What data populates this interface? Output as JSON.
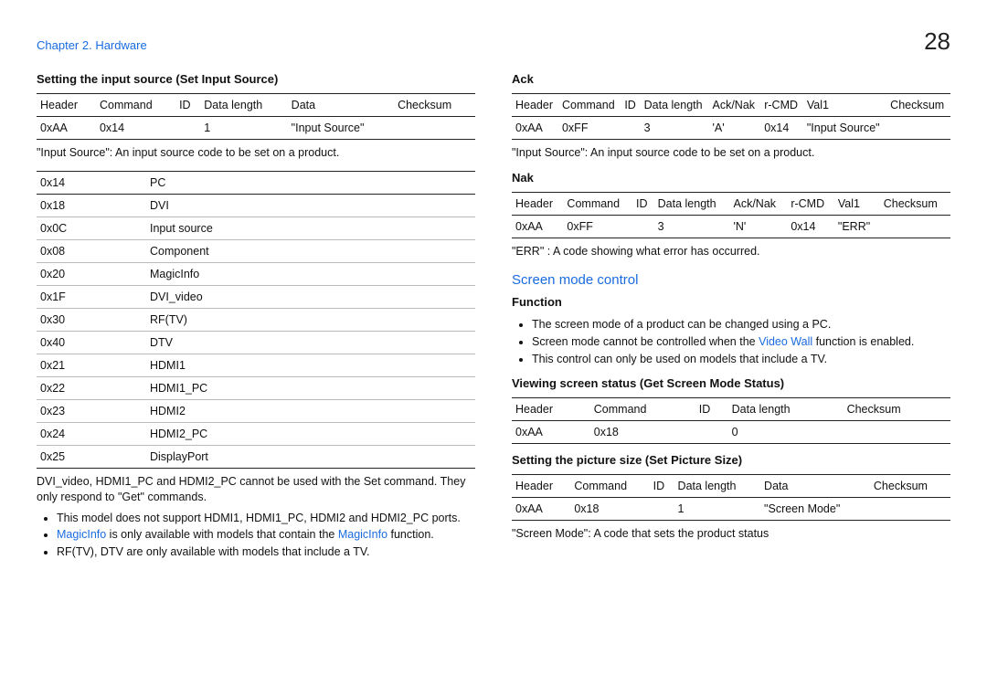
{
  "chapter": "Chapter 2. Hardware",
  "page_number": "28",
  "left": {
    "set_input_source": {
      "title": "Setting the input source (Set Input Source)",
      "table": {
        "headers": [
          "Header",
          "Command",
          "ID",
          "Data length",
          "Data",
          "Checksum"
        ],
        "row": [
          "0xAA",
          "0x14",
          "",
          "1",
          "\"Input Source\"",
          ""
        ]
      },
      "desc": "\"Input Source\": An input source code to be set on a product.",
      "codes": {
        "rows": [
          [
            "0x14",
            "PC"
          ],
          [
            "0x18",
            "DVI"
          ],
          [
            "0x0C",
            "Input source"
          ],
          [
            "0x08",
            "Component"
          ],
          [
            "0x20",
            "MagicInfo"
          ],
          [
            "0x1F",
            "DVI_video"
          ],
          [
            "0x30",
            "RF(TV)"
          ],
          [
            "0x40",
            "DTV"
          ],
          [
            "0x21",
            "HDMI1"
          ],
          [
            "0x22",
            "HDMI1_PC"
          ],
          [
            "0x23",
            "HDMI2"
          ],
          [
            "0x24",
            "HDMI2_PC"
          ],
          [
            "0x25",
            "DisplayPort"
          ]
        ]
      },
      "note1": "DVI_video, HDMI1_PC and HDMI2_PC cannot be used with the Set command. They only respond to \"Get\" commands.",
      "bullets": [
        {
          "pre": "This model does not support HDMI1, HDMI1_PC, HDMI2 and HDMI2_PC ports."
        },
        {
          "pre": "",
          "link1": "MagicInfo",
          "mid": " is only available with models that contain the ",
          "link2": "MagicInfo",
          "post": " function."
        },
        {
          "pre": "RF(TV), DTV are only available with models that include a TV."
        }
      ]
    }
  },
  "right": {
    "ack": {
      "title": "Ack",
      "headers": [
        "Header",
        "Command",
        "ID",
        "Data length",
        "Ack/Nak",
        "r-CMD",
        "Val1",
        "Checksum"
      ],
      "row": [
        "0xAA",
        "0xFF",
        "",
        "3",
        "'A'",
        "0x14",
        "\"Input Source\"",
        ""
      ],
      "desc": "\"Input Source\": An input source code to be set on a product."
    },
    "nak": {
      "title": "Nak",
      "headers": [
        "Header",
        "Command",
        "ID",
        "Data length",
        "Ack/Nak",
        "r-CMD",
        "Val1",
        "Checksum"
      ],
      "row": [
        "0xAA",
        "0xFF",
        "",
        "3",
        "'N'",
        "0x14",
        "\"ERR\"",
        ""
      ],
      "desc": "\"ERR\" : A code showing what error has occurred."
    },
    "screen_mode": {
      "title": "Screen mode control",
      "function_label": "Function",
      "bullets": [
        {
          "text": "The screen mode of a product can be changed using a PC."
        },
        {
          "pre": "Screen mode cannot be controlled when the ",
          "link": "Video Wall",
          "post": " function is enabled."
        },
        {
          "text": "This control can only be used on models that include a TV."
        }
      ],
      "get": {
        "title": "Viewing screen status (Get Screen Mode Status)",
        "headers": [
          "Header",
          "Command",
          "ID",
          "Data length",
          "Checksum"
        ],
        "row": [
          "0xAA",
          "0x18",
          "",
          "0",
          ""
        ]
      },
      "set": {
        "title": "Setting the picture size (Set Picture Size)",
        "headers": [
          "Header",
          "Command",
          "ID",
          "Data length",
          "Data",
          "Checksum"
        ],
        "row": [
          "0xAA",
          "0x18",
          "",
          "1",
          "\"Screen Mode\"",
          ""
        ],
        "desc": "\"Screen Mode\": A code that sets the product status"
      }
    }
  }
}
